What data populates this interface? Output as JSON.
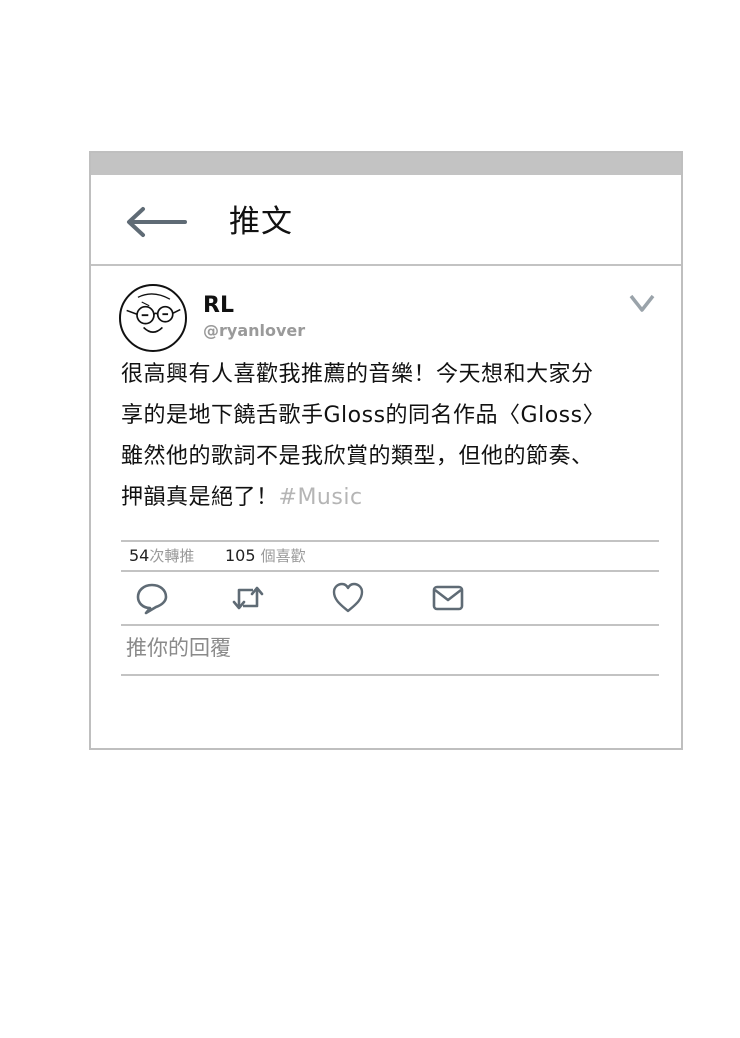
{
  "header": {
    "title": "推文",
    "back_icon": "arrow-left-icon"
  },
  "tweet": {
    "author": {
      "display_name": "RL",
      "handle": "@ryanlover",
      "avatar_icon": "doodle-face-with-glasses"
    },
    "menu_icon": "chevron-down-icon",
    "text_lines": [
      "很高興有人喜歡我推薦的音樂！今天想和大家分",
      "享的是地下饒舌歌手Gloss的同名作品〈Gloss〉",
      "雖然他的歌詞不是我欣賞的類型，但他的節奏、",
      "押韻真是絕了！"
    ],
    "hashtag": "#Music",
    "stats": {
      "retweets_count": "54",
      "retweets_label": "次轉推",
      "likes_count": "105",
      "likes_label": "個喜歡"
    },
    "actions": {
      "reply_icon": "speech-bubble-icon",
      "retweet_icon": "retweet-arrows-icon",
      "like_icon": "heart-icon",
      "message_icon": "envelope-icon"
    },
    "reply_placeholder": "推你的回覆"
  },
  "colors": {
    "border": "#c3c3c3",
    "icon": "#5f6b75",
    "muted_text": "#9a9a9a",
    "hashtag": "#b5b5b5"
  }
}
